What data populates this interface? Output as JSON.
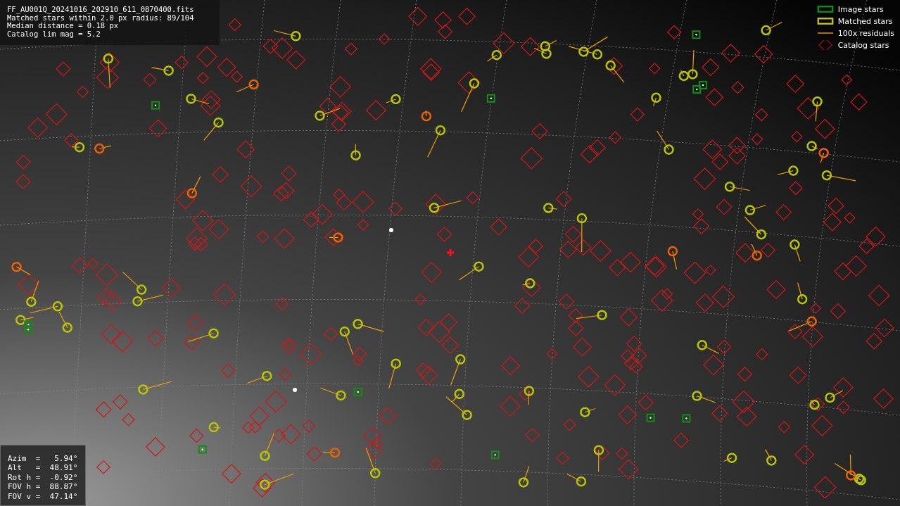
{
  "info_box": {
    "lines": [
      "FF_AU001Q_20241016_202910_611_0870400.fits",
      "Matched stars within 2.0 px radius: 89/104",
      "Median distance = 0.18 px",
      "Catalog lim mag = 5.2"
    ]
  },
  "legend": [
    {
      "label": "Image stars"
    },
    {
      "kind": "matched",
      "label": "Matched stars"
    },
    {
      "kind": "residual",
      "label": "100x residuals"
    },
    {
      "kind": "catalog",
      "label": "Catalog stars"
    }
  ],
  "pointing": [
    {
      "label": "Azim",
      "sep": "=",
      "value": "5.94°"
    },
    {
      "label": "Alt",
      "sep": "=",
      "value": "48.91°"
    },
    {
      "label": "Rot h",
      "sep": "=",
      "value": "-0.92°"
    },
    {
      "label": "FOV h",
      "sep": "=",
      "value": "88.87°"
    },
    {
      "label": "FOV v",
      "sep": "=",
      "value": "47.14°"
    }
  ]
}
